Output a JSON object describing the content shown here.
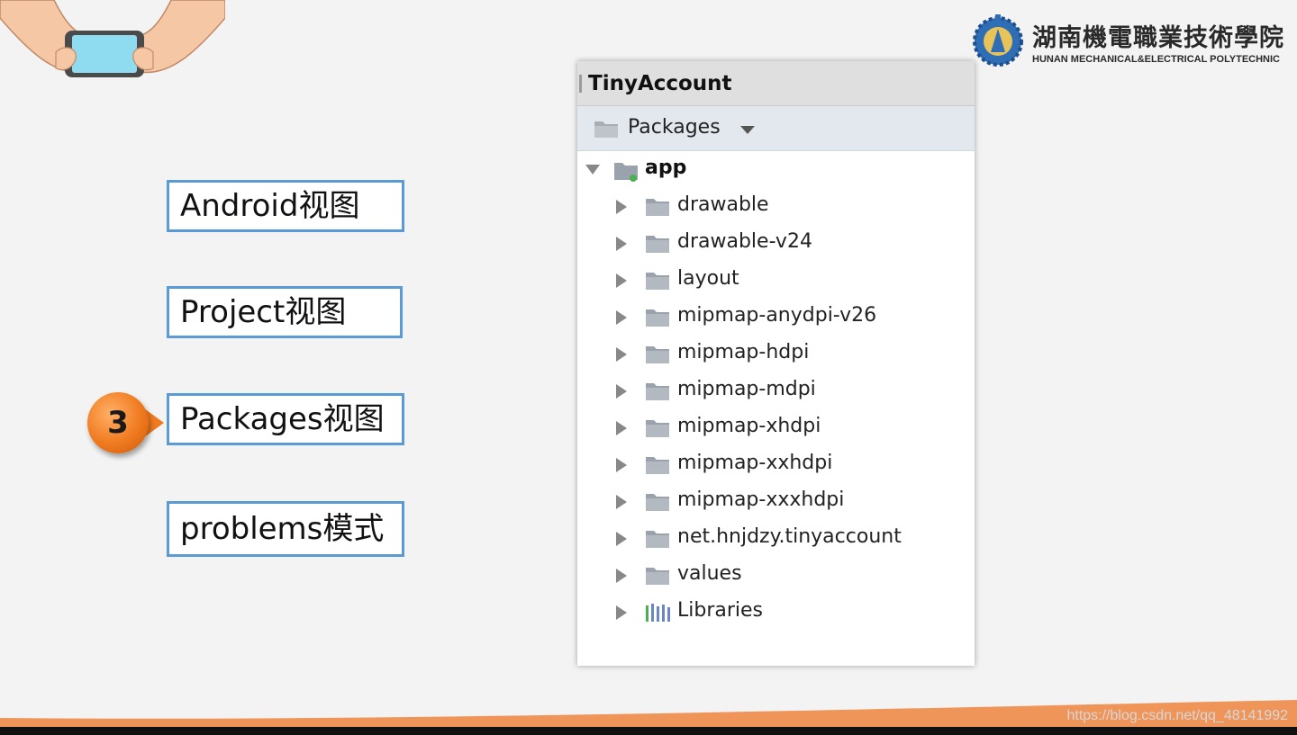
{
  "logo": {
    "name_cn": "湖南機電職業技術學院",
    "name_en": "HUNAN MECHANICAL&ELECTRICAL POLYTECHNIC"
  },
  "options": {
    "android": "Android视图",
    "project": "Project视图",
    "packages": "Packages视图",
    "problems": "problems模式"
  },
  "step_badge": "3",
  "panel": {
    "title": "TinyAccount",
    "view_selector": "Packages",
    "tree": {
      "root": "app",
      "items": [
        "drawable",
        "drawable-v24",
        "layout",
        "mipmap-anydpi-v26",
        "mipmap-hdpi",
        "mipmap-mdpi",
        "mipmap-xhdpi",
        "mipmap-xxhdpi",
        "mipmap-xxxhdpi",
        "net.hnjdzy.tinyaccount",
        "values",
        "Libraries"
      ]
    }
  },
  "watermark": "https://blog.csdn.net/qq_48141992",
  "colors": {
    "accent_orange": "#f07a1f",
    "box_border": "#5b9bd5",
    "footer_orange": "#f0955a"
  }
}
